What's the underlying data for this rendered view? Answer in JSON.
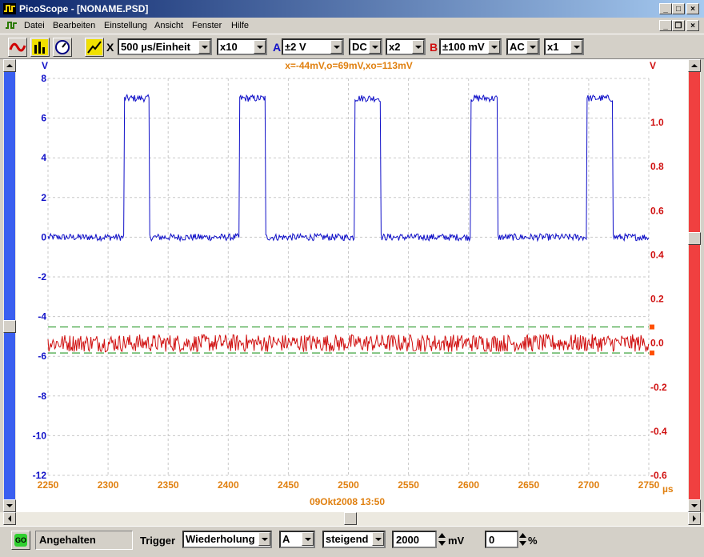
{
  "window": {
    "title": "PicoScope - [NONAME.PSD]"
  },
  "menu": {
    "items": [
      "Datei",
      "Bearbeiten",
      "Einstellung",
      "Ansicht",
      "Fenster",
      "Hilfe"
    ]
  },
  "toolbar": {
    "x_label": "X",
    "timebase": "500 µs/Einheit",
    "zoom": "x10",
    "channel_a_label": "A",
    "channel_a_range": "±2 V",
    "channel_a_coupling": "DC",
    "channel_a_multiplier": "x2",
    "channel_b_label": "B",
    "channel_b_range": "±100 mV",
    "channel_b_coupling": "AC",
    "channel_b_multiplier": "x1"
  },
  "plot": {
    "measurement": "x=-44mV,o=69mV,xo=113mV",
    "left_unit": "V",
    "right_unit": "V",
    "x_unit": "µs",
    "timestamp": "09Okt2008  13:50"
  },
  "colors": {
    "channel_a": "#1010c8",
    "channel_b": "#d01010",
    "x_axis": "#e08010",
    "markers": "#2a9a2a"
  },
  "chart_data": {
    "type": "line",
    "x_ticks": [
      "2250",
      "2300",
      "2350",
      "2400",
      "2450",
      "2500",
      "2550",
      "2600",
      "2650",
      "2700",
      "2750"
    ],
    "xlim": [
      2250,
      2750
    ],
    "left_ticks": [
      "8",
      "6",
      "4",
      "2",
      "0",
      "-2",
      "-4",
      "-6",
      "-8",
      "-10",
      "-12"
    ],
    "ylim_left": [
      -12,
      8
    ],
    "right_ticks": [
      "1.0",
      "0.8",
      "0.6",
      "0.4",
      "0.2",
      "0.0",
      "-0.2",
      "-0.4",
      "-0.6"
    ],
    "ylim_right": [
      -0.6,
      1.2
    ],
    "grid": true,
    "series": [
      {
        "channel": "A",
        "kind": "pulse",
        "low": 0,
        "high": 7,
        "pulses": [
          [
            2313,
            2334
          ],
          [
            2409,
            2431
          ],
          [
            2505,
            2527
          ],
          [
            2602,
            2624
          ],
          [
            2698,
            2720
          ]
        ]
      },
      {
        "channel": "B",
        "kind": "noise",
        "mean": 0.0,
        "amplitude": 0.05
      }
    ],
    "markers": [
      {
        "channel": "B",
        "value": 0.073
      },
      {
        "channel": "B",
        "value": -0.045
      }
    ]
  },
  "status": {
    "go_label": "GO",
    "state": "Angehalten",
    "trigger_label": "Trigger",
    "trigger_mode": "Wiederholung",
    "trigger_channel": "A",
    "trigger_edge": "steigend",
    "trigger_level": "2000",
    "trigger_level_unit": "mV",
    "pretrigger": "0",
    "pretrigger_unit": "%"
  }
}
